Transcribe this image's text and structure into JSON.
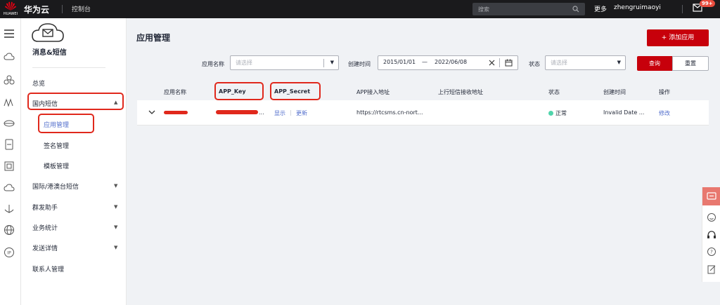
{
  "topbar": {
    "logo_text": "HUAWEI",
    "brand": "华为云",
    "console": "控制台",
    "search_placeholder": "搜索",
    "more": "更多",
    "user": "zhengruimaoyi",
    "badge": "99+"
  },
  "sidebar": {
    "service_title": "消息&短信",
    "items": [
      {
        "label": "总览"
      },
      {
        "label": "国内短信"
      },
      {
        "label": "应用管理"
      },
      {
        "label": "签名管理"
      },
      {
        "label": "模板管理"
      },
      {
        "label": "国际/港澳台短信"
      },
      {
        "label": "群发助手"
      },
      {
        "label": "业务统计"
      },
      {
        "label": "发送详情"
      },
      {
        "label": "联系人管理"
      }
    ]
  },
  "main": {
    "title": "应用管理",
    "add_button": "+ 添加应用",
    "filters": {
      "app_name_label": "应用名称",
      "app_name_placeholder": "请选择",
      "created_label": "创建时间",
      "date_start": "2015/01/01",
      "date_sep": "—",
      "date_end": "2022/06/08",
      "status_label": "状态",
      "status_placeholder": "请选择",
      "query": "查询",
      "reset": "重置"
    },
    "table": {
      "headers": [
        "应用名称",
        "APP_Key",
        "APP_Secret",
        "APP接入地址",
        "上行短信接收地址",
        "状态",
        "创建时间",
        "操作"
      ],
      "rows": [
        {
          "key_suffix": "...",
          "secret_show": "显示",
          "secret_update": "更新",
          "access_url": "https://rtcsms.cn-nort...",
          "status": "正常",
          "created": "Invalid Date ...",
          "action": "修改"
        }
      ]
    }
  },
  "colors": {
    "accent": "#c7000b",
    "link": "#526ecc",
    "annotation": "#e0281c",
    "status_ok": "#50d4ab"
  }
}
